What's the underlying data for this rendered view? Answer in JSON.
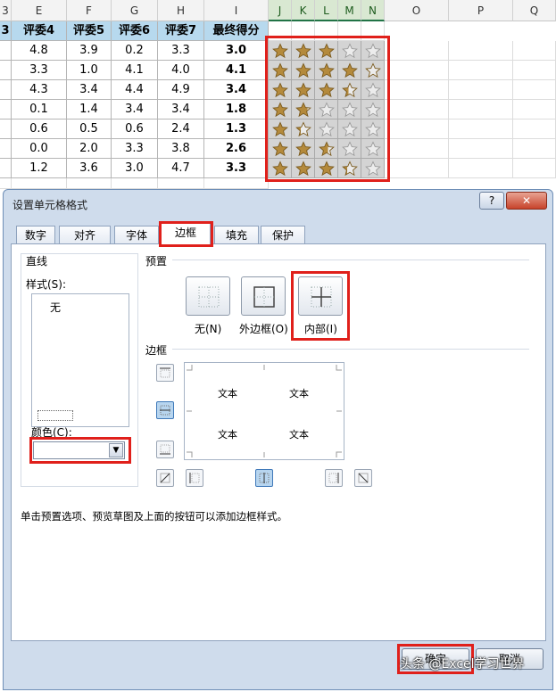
{
  "sheet": {
    "columns": [
      "3",
      "E",
      "F",
      "G",
      "H",
      "I",
      "J",
      "K",
      "L",
      "M",
      "N",
      "O",
      "P",
      "Q"
    ],
    "header_row": [
      "3",
      "评委4",
      "评委5",
      "评委6",
      "评委7",
      "最终得分"
    ],
    "rows": [
      [
        "4.8",
        "3.9",
        "0.2",
        "3.3",
        "3.0"
      ],
      [
        "3.3",
        "1.0",
        "4.1",
        "4.0",
        "4.1"
      ],
      [
        "4.3",
        "3.4",
        "4.4",
        "4.9",
        "3.4"
      ],
      [
        "0.1",
        "1.4",
        "3.4",
        "3.4",
        "1.8"
      ],
      [
        "0.6",
        "0.5",
        "0.6",
        "2.4",
        "1.3"
      ],
      [
        "0.0",
        "2.0",
        "3.3",
        "3.8",
        "2.6"
      ],
      [
        "1.2",
        "3.6",
        "3.0",
        "4.7",
        "3.3"
      ]
    ],
    "star_rating_scale": 5,
    "star_colors": {
      "filled": "#b48a3c",
      "outline": "#9a9a9a",
      "cell_bg": "#d4d4d4"
    }
  },
  "dialog": {
    "title": "设置单元格格式",
    "help_label": "?",
    "close_label": "✕",
    "tabs": [
      "数字",
      "对齐",
      "字体",
      "边框",
      "填充",
      "保护"
    ],
    "active_tab": "边框",
    "line_group_label": "直线",
    "style_label": "样式(S):",
    "style_none": "无",
    "color_label": "颜色(C):",
    "color_dropdown_icon": "chevron-down-icon",
    "preset_label": "预置",
    "presets": [
      "无(N)",
      "外边框(O)",
      "内部(I)"
    ],
    "border_label": "边框",
    "preview_text": [
      "文本",
      "文本",
      "文本",
      "文本"
    ],
    "hint": "单击预置选项、预览草图及上面的按钮可以添加边框样式。",
    "ok_label": "确定",
    "cancel_label": "取消"
  },
  "watermark": "头条 @Excel学习世界",
  "highlight_color": "#e0201b"
}
